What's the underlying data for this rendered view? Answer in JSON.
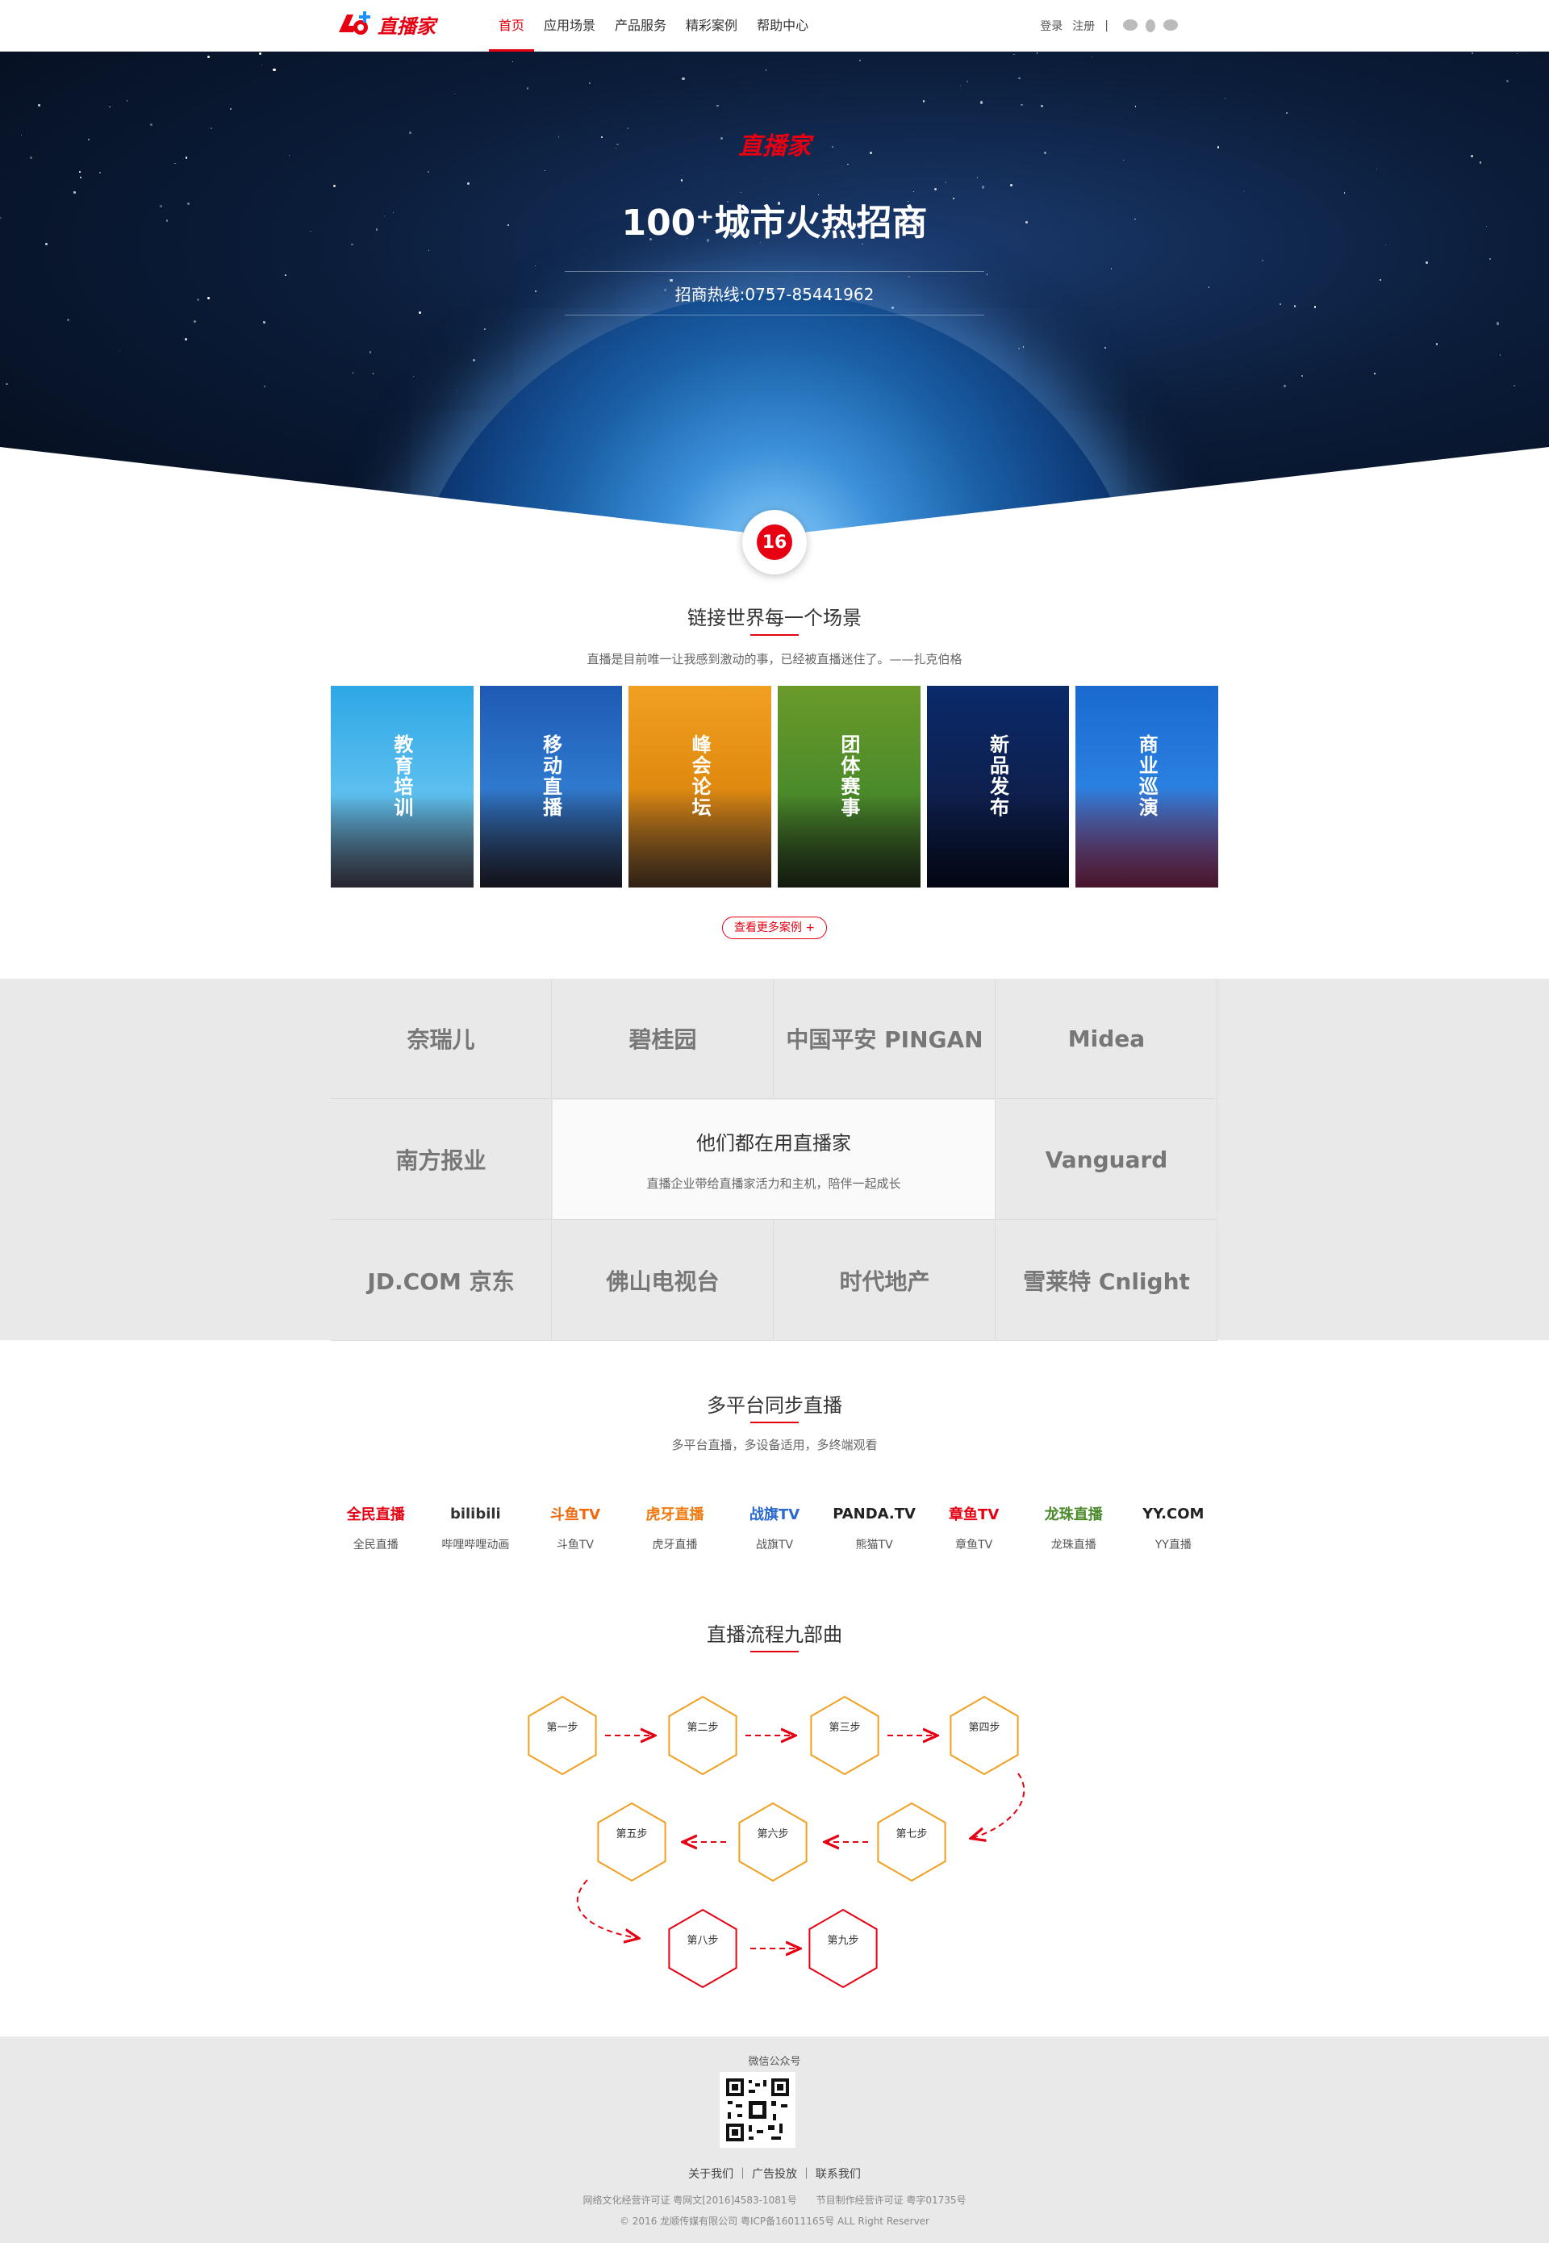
{
  "brand": {
    "name": "直播家",
    "mark": "16"
  },
  "nav": {
    "items": [
      {
        "label": "首页",
        "active": true
      },
      {
        "label": "应用场景"
      },
      {
        "label": "产品服务"
      },
      {
        "label": "精彩案例"
      },
      {
        "label": "帮助中心"
      }
    ],
    "login": "登录",
    "register": "注册",
    "divider": "|"
  },
  "hero": {
    "title": "100⁺城市火热招商",
    "hotline": "招商热线:0757-85441962"
  },
  "scenes_section": {
    "title": "链接世界每一个场景",
    "subtitle": "直播是目前唯一让我感到激动的事，已经被直播迷住了。——扎克伯格",
    "items": [
      {
        "label": "教育培训"
      },
      {
        "label": "移动直播"
      },
      {
        "label": "峰会论坛"
      },
      {
        "label": "团体赛事"
      },
      {
        "label": "新品发布"
      },
      {
        "label": "商业巡演"
      }
    ],
    "more": "查看更多案例 +"
  },
  "partners": {
    "center_title": "他们都在用直播家",
    "center_sub": "直播企业带给直播家活力和主机，陪伴一起成长",
    "logos": [
      "奈瑞儿",
      "碧桂园",
      "中国平安 PINGAN",
      "Midea",
      "南方报业",
      "Vanguard",
      "JD.COM 京东",
      "佛山电视台",
      "时代地产",
      "雪莱特 Cnlight"
    ]
  },
  "platforms": {
    "title": "多平台同步直播",
    "subtitle": "多平台直播，多设备适用，多终端观看",
    "items": [
      {
        "logo": "全民直播",
        "name": "全民直播"
      },
      {
        "logo": "bilibili",
        "name": "哔哩哔哩动画"
      },
      {
        "logo": "斗鱼TV",
        "name": "斗鱼TV"
      },
      {
        "logo": "虎牙直播",
        "name": "虎牙直播"
      },
      {
        "logo": "战旗TV",
        "name": "战旗TV"
      },
      {
        "logo": "PANDA.TV",
        "name": "熊猫TV"
      },
      {
        "logo": "章鱼TV",
        "name": "章鱼TV"
      },
      {
        "logo": "龙珠直播",
        "name": "龙珠直播"
      },
      {
        "logo": "YY.COM",
        "name": "YY直播"
      }
    ]
  },
  "flow": {
    "title": "直播流程九部曲",
    "steps": [
      "第一步",
      "第二步",
      "第三步",
      "第四步",
      "第五步",
      "第六步",
      "第七步",
      "第八步",
      "第九步"
    ]
  },
  "footer": {
    "wechat": "微信公众号",
    "links": "关于我们 ｜ 广告投放 ｜ 联系我们",
    "license": "网络文化经营许可证 粤网文[2016]4583-1081号　　节目制作经营许可证 粤字01735号",
    "copyright": "© 2016 龙顺传媒有限公司 粤ICP备16011165号 ALL Right Reserver"
  },
  "colors": {
    "accent": "#e60012",
    "step_orange": "#f0a020",
    "step_red": "#e60012"
  }
}
